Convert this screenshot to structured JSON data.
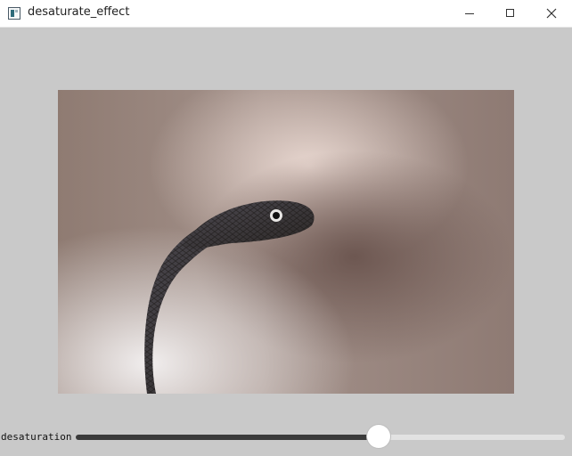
{
  "window": {
    "title": "desaturate_effect",
    "icon": "app-window-icon",
    "controls": [
      "minimize-icon",
      "maximize-icon",
      "close-icon"
    ]
  },
  "image": {
    "subject": "cobra snake photograph"
  },
  "slider": {
    "label": "desaturation",
    "value_fraction": 0.62,
    "colors": {
      "filled": "#3a3a3a",
      "track": "#e2e2e2",
      "thumb": "#ffffff"
    }
  }
}
